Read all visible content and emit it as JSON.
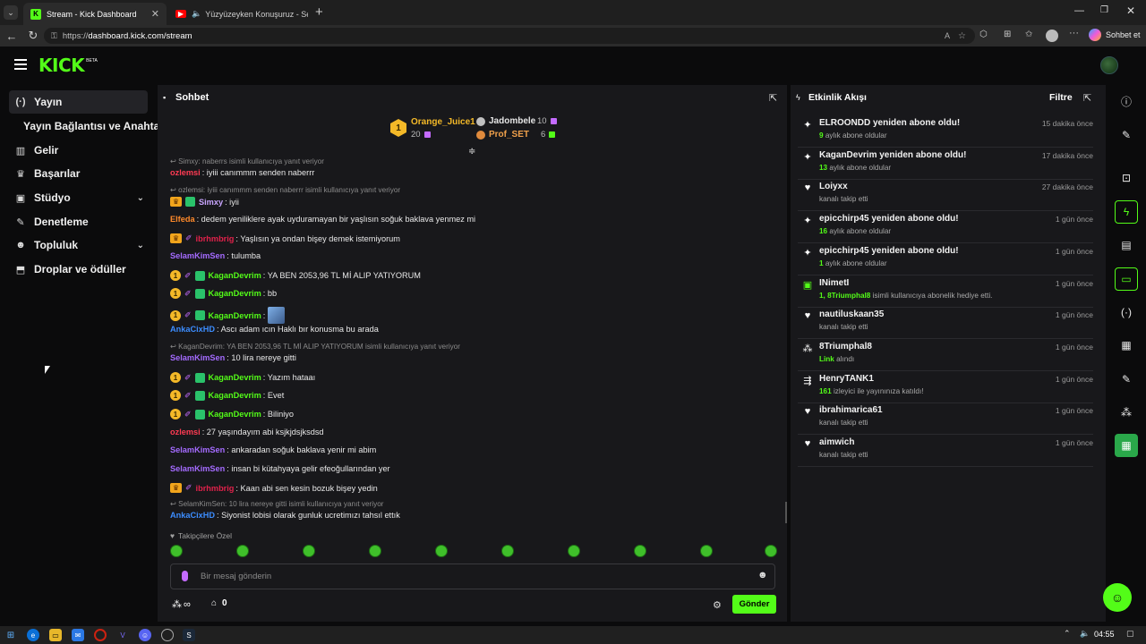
{
  "browser": {
    "tabs": [
      {
        "title": "Stream - Kick Dashboard",
        "active": true
      },
      {
        "title": "Yüzyüzeyken Konuşuruz - Ser",
        "active": false
      }
    ],
    "url_prefix": "https://",
    "url_host": "dashboard.kick.com/stream",
    "copilot_label": "Sohbet et"
  },
  "app": {
    "logo_text": "KICK",
    "logo_beta": "BETA"
  },
  "sidebar": {
    "items": [
      {
        "label": "Yayın",
        "icon": "broadcast-icon",
        "active": true
      },
      {
        "label": "Yayın Bağlantısı ve Anahtarı",
        "sub": true
      },
      {
        "label": "Gelir",
        "icon": "chart-icon"
      },
      {
        "label": "Başarılar",
        "icon": "trophy-icon"
      },
      {
        "label": "Stüdyo",
        "icon": "studio-icon",
        "expand": true
      },
      {
        "label": "Denetleme",
        "icon": "wrench-icon"
      },
      {
        "label": "Topluluk",
        "icon": "community-icon",
        "expand": true
      },
      {
        "label": "Droplar ve ödüller",
        "icon": "drops-icon"
      }
    ]
  },
  "chat": {
    "title": "Sohbet",
    "leaderboard": {
      "first": {
        "name": "Orange_Juice1",
        "count": "20",
        "rank": "1"
      },
      "second": {
        "name": "Jadombele",
        "count": "10"
      },
      "third": {
        "name": "Prof_SET",
        "count": "6"
      }
    },
    "followers_only": "Takipçilere Özel",
    "input_placeholder": "Bir mesaj gönderin",
    "send_label": "Gönder",
    "viewer_count": "0",
    "messages": [
      {
        "type": "reply",
        "text": "Simxy: naberrs isimli kullanıcıya yanıt veriyor"
      },
      {
        "user": "ozlemsi",
        "color": "#ff3b53",
        "text": ": iyiii canımmm senden naberrr"
      },
      {
        "type": "reply",
        "text": "ozlemsi: iyiii canımmm senden naberrr isimli kullanıcıya yanıt veriyor"
      },
      {
        "user": "Simxy",
        "color": "#c9a5ff",
        "text": ": iyii",
        "badges": [
          "crown",
          "sub"
        ]
      },
      {
        "user": "Elfeda",
        "color": "#ff8a2a",
        "text": ": dedem yeniliklere ayak uyduramayan bir yaşlısın soğuk baklava yenmez mi"
      },
      {
        "user": "ibrhmbrig",
        "color": "#e0214a",
        "text": ": Yaşlısın ya ondan bişey demek istemiyorum",
        "badges": [
          "crown",
          "pen"
        ]
      },
      {
        "user": "SelamKimSen",
        "color": "#a46bff",
        "text": ": tulumba"
      },
      {
        "user": "KaganDevrim",
        "color": "#53fc18",
        "text": ": YA BEN 2053,96 TL Mİ ALIP YATIYORUM",
        "badges": [
          "gold",
          "pen",
          "sub"
        ]
      },
      {
        "user": "KaganDevrim",
        "color": "#53fc18",
        "text": ": bb",
        "badges": [
          "gold",
          "pen",
          "sub"
        ]
      },
      {
        "user": "KaganDevrim",
        "color": "#53fc18",
        "text": ":",
        "badges": [
          "gold",
          "pen",
          "sub"
        ],
        "emote": true
      },
      {
        "user": "AnkaCixHD",
        "color": "#3c8dff",
        "text": ": Ascı adam ıcın Haklı bır konusma bu arada"
      },
      {
        "type": "reply",
        "text": "KaganDevrim: YA BEN 2053,96 TL Mİ ALIP YATIYORUM isimli kullanıcıya yanıt veriyor"
      },
      {
        "user": "SelamKimSen",
        "color": "#a46bff",
        "text": ": 10 lira nereye gitti"
      },
      {
        "user": "KaganDevrim",
        "color": "#53fc18",
        "text": ": Yazım hataaı",
        "badges": [
          "gold",
          "pen",
          "sub"
        ]
      },
      {
        "user": "KaganDevrim",
        "color": "#53fc18",
        "text": ": Evet",
        "badges": [
          "gold",
          "pen",
          "sub"
        ]
      },
      {
        "user": "KaganDevrim",
        "color": "#53fc18",
        "text": ": Biliniyo",
        "badges": [
          "gold",
          "pen",
          "sub"
        ]
      },
      {
        "user": "ozlemsi",
        "color": "#ff3b53",
        "text": ": 27 yaşındayım abi ksjkjdsjksdsd"
      },
      {
        "user": "SelamKimSen",
        "color": "#a46bff",
        "text": ": ankaradan soğuk baklava yenir mi abim"
      },
      {
        "user": "SelamKimSen",
        "color": "#a46bff",
        "text": ": insan bi kütahyaya gelir efeoğullarından yer"
      },
      {
        "user": "ibrhmbrig",
        "color": "#e0214a",
        "text": ": Kaan abi sen kesin bozuk bişey yedin",
        "badges": [
          "crown",
          "pen"
        ]
      },
      {
        "type": "reply",
        "text": "SelamKimSen: 10 lira nereye gitti isimli kullanıcıya yanıt veriyor"
      },
      {
        "user": "AnkaCixHD",
        "color": "#3c8dff",
        "text": ": Siyonist lobisi olarak gunluk ucretimızı tahsıl ettık"
      }
    ]
  },
  "activity": {
    "title": "Etkinlik Akışı",
    "filter_label": "Filtre",
    "items": [
      {
        "icon": "sparkle-icon",
        "title": "ELROONDD yeniden abone oldu!",
        "sub_hl": "9",
        "sub": " aylık abone oldular",
        "time": "15 dakika önce"
      },
      {
        "icon": "sparkle-icon",
        "title": "KaganDevrim yeniden abone oldu!",
        "sub_hl": "13",
        "sub": " aylık abone oldular",
        "time": "17 dakika önce"
      },
      {
        "icon": "heart-icon",
        "title": "Loiyxx",
        "sub_hl": "",
        "sub": "kanalı takip etti",
        "time": "27 dakika önce"
      },
      {
        "icon": "sparkle-icon",
        "title": "epicchirp45 yeniden abone oldu!",
        "sub_hl": "16",
        "sub": " aylık abone oldular",
        "time": "1 gün önce"
      },
      {
        "icon": "sparkle-icon",
        "title": "epicchirp45 yeniden abone oldu!",
        "sub_hl": "1",
        "sub": " aylık abone oldular",
        "time": "1 gün önce"
      },
      {
        "icon": "gift-icon",
        "title": "INimetI",
        "sub_hl": "1, 8Triumphal8",
        "sub": " isimli kullanıcıya abonelik hediye etti.",
        "time": "1 gün önce"
      },
      {
        "icon": "heart-icon",
        "title": "nautiluskaan35",
        "sub_hl": "",
        "sub": "kanalı takip etti",
        "time": "1 gün önce"
      },
      {
        "icon": "drops-icon",
        "title": "8Triumphal8",
        "sub_hl": "Link",
        "sub": " alındı",
        "time": "1 gün önce"
      },
      {
        "icon": "raid-icon",
        "title": "HenryTANK1",
        "sub_hl": "161",
        "sub": " izleyici ile yayınınıza katıldı!",
        "time": "1 gün önce"
      },
      {
        "icon": "heart-icon",
        "title": "ibrahimarica61",
        "sub_hl": "",
        "sub": "kanalı takip etti",
        "time": "1 gün önce"
      },
      {
        "icon": "heart-icon",
        "title": "aimwich",
        "sub_hl": "",
        "sub": "kanalı takip etti",
        "time": "1 gün önce"
      }
    ]
  },
  "taskbar": {
    "time": "04:55"
  },
  "colors": {
    "accent": "#53fc18",
    "panel": "#18181b",
    "bg": "#0b0b0c"
  }
}
